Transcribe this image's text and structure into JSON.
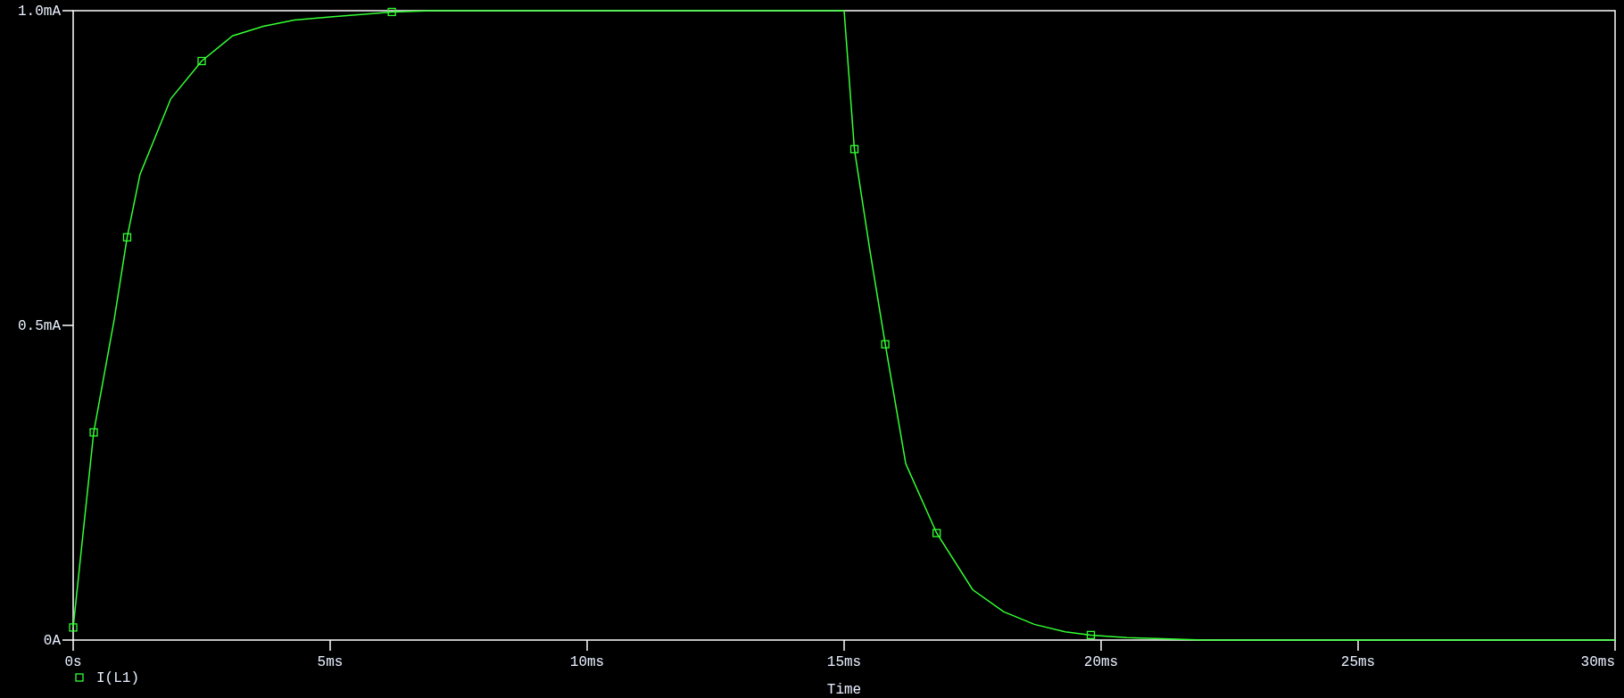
{
  "chart_data": {
    "type": "line",
    "xlabel": "Time",
    "xlim": [
      0,
      30
    ],
    "ylim": [
      0,
      1
    ],
    "xticks": [
      {
        "value": 0,
        "label": "0s"
      },
      {
        "value": 5,
        "label": "5ms"
      },
      {
        "value": 10,
        "label": "10ms"
      },
      {
        "value": 15,
        "label": "15ms"
      },
      {
        "value": 20,
        "label": "20ms"
      },
      {
        "value": 25,
        "label": "25ms"
      },
      {
        "value": 30,
        "label": "30ms"
      }
    ],
    "yticks": [
      {
        "value": 0,
        "label": "0A"
      },
      {
        "value": 0.5,
        "label": "0.5mA"
      },
      {
        "value": 1,
        "label": "1.0mA"
      }
    ],
    "x": [
      0,
      0.4,
      0.8,
      1.05,
      1.3,
      1.9,
      2.5,
      3.1,
      3.7,
      4.3,
      5,
      6.2,
      7,
      10,
      15,
      15.2,
      15.5,
      15.8,
      16.2,
      16.8,
      17.5,
      18.1,
      18.7,
      19.3,
      19.8,
      20.5,
      21.2,
      22,
      25,
      30
    ],
    "series": [
      {
        "name": "I(L1)",
        "color": "#33ff33",
        "values": [
          0.02,
          0.33,
          0.51,
          0.64,
          0.74,
          0.86,
          0.92,
          0.96,
          0.975,
          0.985,
          0.99,
          0.998,
          1.0,
          1.0,
          1.0,
          0.78,
          0.62,
          0.47,
          0.28,
          0.17,
          0.08,
          0.045,
          0.025,
          0.013,
          0.008,
          0.004,
          0.002,
          0.0,
          0.0,
          0.0
        ]
      }
    ]
  }
}
